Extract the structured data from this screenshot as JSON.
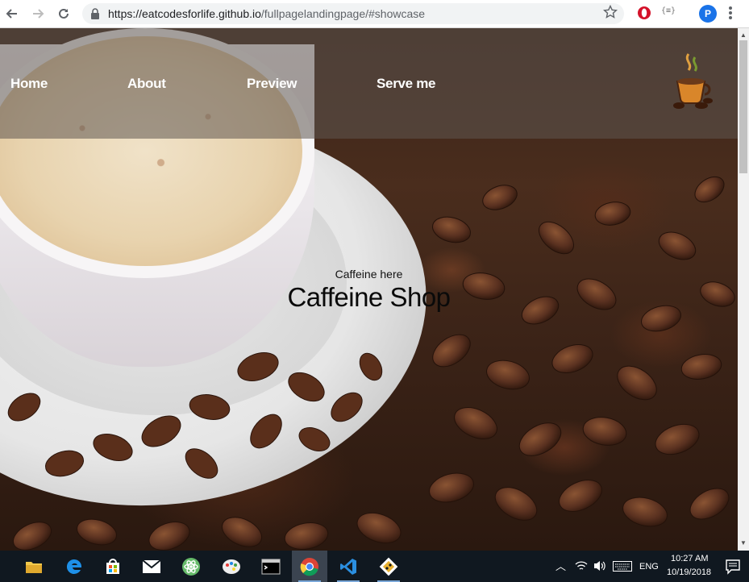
{
  "browser": {
    "url_host": "https://eatcodesforlife.github.io",
    "url_path": "/fullpagelandingpage/#showcase",
    "ext_json_label": "{≡}",
    "profile_initial": "P"
  },
  "nav": {
    "items": [
      {
        "label": "Home"
      },
      {
        "label": "About"
      },
      {
        "label": "Preview"
      },
      {
        "label": "Serve me"
      }
    ]
  },
  "hero": {
    "subtitle": "Caffeine here",
    "title": "Caffeine Shop"
  },
  "taskbar": {
    "apps": [
      {
        "name": "file-explorer-icon"
      },
      {
        "name": "edge-icon"
      },
      {
        "name": "store-icon"
      },
      {
        "name": "mail-icon"
      },
      {
        "name": "atom-icon"
      },
      {
        "name": "paint-icon"
      },
      {
        "name": "terminal-icon"
      },
      {
        "name": "chrome-icon"
      },
      {
        "name": "vscode-icon"
      },
      {
        "name": "git-icon"
      }
    ],
    "language": "ENG",
    "time": "10:27 AM",
    "date": "10/19/2018"
  },
  "colors": {
    "taskbar": "#101820",
    "nav_overlay": "#5f5550",
    "accent": "#1a73e8"
  }
}
